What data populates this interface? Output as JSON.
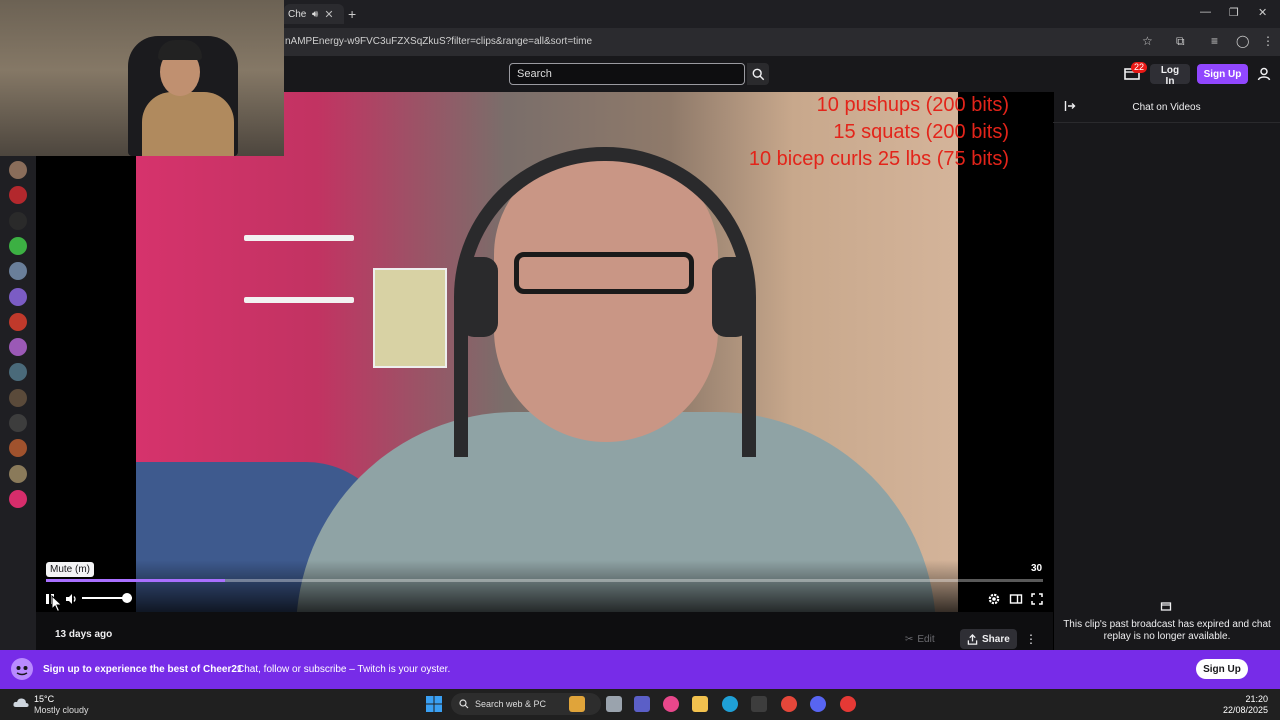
{
  "browser": {
    "tab_title": "Cheer",
    "url": "nAMPEnergy-w9FVC3uFZXSqZkuS?filter=clips&range=all&sort=time"
  },
  "nav": {
    "search_placeholder": "Search",
    "notification_count": "22",
    "login_label": "Log In",
    "signup_label": "Sign Up"
  },
  "video": {
    "overlay_lines": [
      "10 pushups (200 bits)",
      "15 squats (200 bits)",
      "10 bicep curls 25 lbs (75 bits)"
    ],
    "overlay_color": "#e3241a",
    "tooltip": "Mute (m)",
    "counter": "30",
    "progress_fraction": 0.18,
    "volume_fraction": 0.9,
    "accent": "#a970ff"
  },
  "info": {
    "time_ago": "13 days ago",
    "edit_label": "Edit",
    "share_label": "Share"
  },
  "chat": {
    "title": "Chat on Videos",
    "empty_message": "This clip's past broadcast has expired and chat replay is no longer available."
  },
  "banner": {
    "title": "Sign up to experience the best of Cheer21",
    "subtitle": "Chat, follow or subscribe – Twitch is your oyster.",
    "signup_label": "Sign Up",
    "color": "#772ce8"
  },
  "taskbar": {
    "temperature": "15°C",
    "weather": "Mostly cloudy",
    "search_label": "Search web & PC",
    "time": "21:20",
    "date": "22/08/2025"
  },
  "sidebar": {
    "avatar_colors": [
      "#8a6d5a",
      "#b3282d",
      "#2a2a2a",
      "#3cb043",
      "#6a7f9a",
      "#7b5cc4",
      "#c0392b",
      "#9b59b6",
      "#4a6a7a",
      "#5a4a3a",
      "#3d3d3d",
      "#a0522d",
      "#8a7a5a",
      "#d62d6b"
    ]
  }
}
